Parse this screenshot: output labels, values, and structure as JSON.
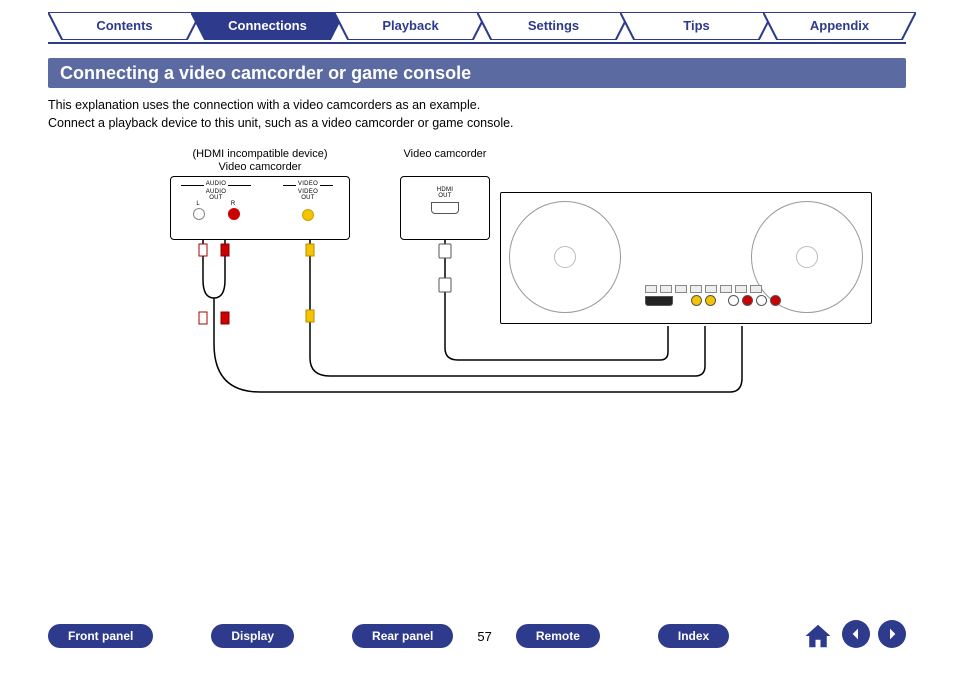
{
  "tabs": [
    {
      "label": "Contents",
      "active": false
    },
    {
      "label": "Connections",
      "active": true
    },
    {
      "label": "Playback",
      "active": false
    },
    {
      "label": "Settings",
      "active": false
    },
    {
      "label": "Tips",
      "active": false
    },
    {
      "label": "Appendix",
      "active": false
    }
  ],
  "section_title": "Connecting a video camcorder or game console",
  "paragraph1": "This explanation uses the connection with a video camcorders as an example.",
  "paragraph2": "Connect a playback device to this unit, such as a video camcorder or game console.",
  "diagram": {
    "device1_note": "(HDMI incompatible device)",
    "device1_name": "Video camcorder",
    "device2_name": "Video camcorder",
    "device1_labels": {
      "audio": "AUDIO",
      "video": "VIDEO",
      "audio_out": "AUDIO OUT",
      "video_out": "VIDEO OUT",
      "l": "L",
      "r": "R"
    },
    "device2_labels": {
      "hdmi_out": "HDMI OUT"
    }
  },
  "bottom_nav": {
    "front_panel": "Front panel",
    "display": "Display",
    "rear_panel": "Rear panel",
    "remote": "Remote",
    "index": "Index"
  },
  "page_number": "57",
  "icons": {
    "home": "home-icon",
    "prev": "arrow-left-icon",
    "next": "arrow-right-icon"
  }
}
